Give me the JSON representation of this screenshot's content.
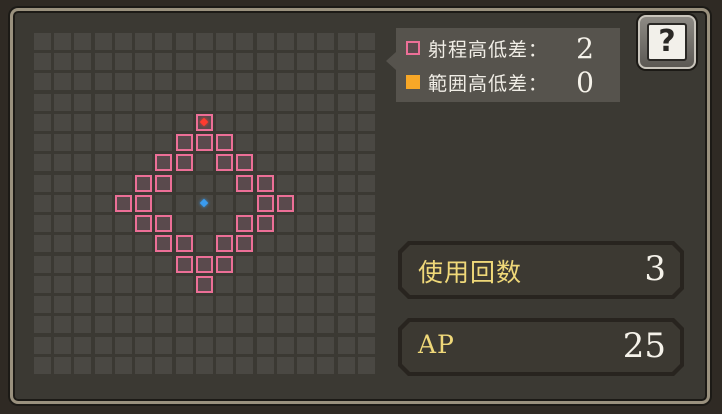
{
  "legend": {
    "items": [
      {
        "label": "射程高低差：",
        "value": "2",
        "color": "#ec6f97",
        "swatch": "outline"
      },
      {
        "label": "範囲高低差：",
        "value": "0",
        "color": "#f7a727",
        "swatch": "solid"
      }
    ]
  },
  "help_button": {
    "icon": "help-book-icon",
    "glyph": "?"
  },
  "stats": {
    "uses_label": "使用回数",
    "uses_value": "3",
    "ap_label": "AP",
    "ap_value": "25"
  },
  "grid": {
    "size": 17,
    "cell_color": "#4a4843",
    "range_color": "#ec6f97",
    "center": [
      8,
      8
    ],
    "target": [
      8,
      4
    ],
    "center_color": "#3a9cf0",
    "target_color": "#ff3b30",
    "range_cells": [
      [
        8,
        4
      ],
      [
        7,
        5
      ],
      [
        8,
        5
      ],
      [
        9,
        5
      ],
      [
        6,
        6
      ],
      [
        7,
        6
      ],
      [
        9,
        6
      ],
      [
        10,
        6
      ],
      [
        5,
        7
      ],
      [
        6,
        7
      ],
      [
        10,
        7
      ],
      [
        11,
        7
      ],
      [
        4,
        8
      ],
      [
        5,
        8
      ],
      [
        11,
        8
      ],
      [
        12,
        8
      ],
      [
        5,
        9
      ],
      [
        6,
        9
      ],
      [
        10,
        9
      ],
      [
        11,
        9
      ],
      [
        6,
        10
      ],
      [
        7,
        10
      ],
      [
        9,
        10
      ],
      [
        10,
        10
      ],
      [
        7,
        11
      ],
      [
        8,
        11
      ],
      [
        9,
        11
      ],
      [
        8,
        12
      ]
    ]
  }
}
